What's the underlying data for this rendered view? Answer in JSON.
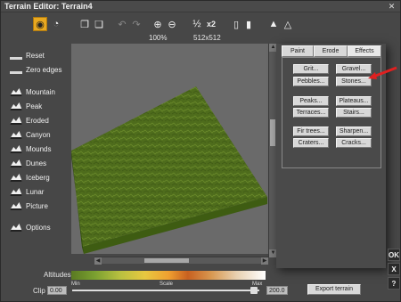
{
  "window": {
    "title": "Terrain Editor: Terrain4",
    "close": "✕"
  },
  "toolbar": {
    "zoom": "100%",
    "resolution": "512x512",
    "x2_label": "x2"
  },
  "left_panel": {
    "items": [
      {
        "label": "Reset",
        "icon": "reset-icon"
      },
      {
        "label": "Zero edges",
        "icon": "zero-edges-icon"
      },
      {
        "label": "Mountain",
        "icon": "mountain-icon"
      },
      {
        "label": "Peak",
        "icon": "peak-icon"
      },
      {
        "label": "Eroded",
        "icon": "eroded-icon"
      },
      {
        "label": "Canyon",
        "icon": "canyon-icon"
      },
      {
        "label": "Mounds",
        "icon": "mounds-icon"
      },
      {
        "label": "Dunes",
        "icon": "dunes-icon"
      },
      {
        "label": "Iceberg",
        "icon": "iceberg-icon"
      },
      {
        "label": "Lunar",
        "icon": "lunar-icon"
      },
      {
        "label": "Picture",
        "icon": "picture-icon"
      },
      {
        "label": "Options",
        "icon": "options-icon"
      }
    ]
  },
  "altitudes": {
    "label": "Altitudes",
    "min": "Min",
    "scale": "Scale",
    "max": "Max"
  },
  "clip": {
    "label": "Clip",
    "min_value": "0.00",
    "max_value": "200.0"
  },
  "export_label": "Export terrain",
  "tabs": [
    "Paint",
    "Erode",
    "Effects"
  ],
  "active_tab": "Effects",
  "effects": [
    [
      "Grit...",
      "Gravel..."
    ],
    [
      "Pebbles...",
      "Stones..."
    ],
    [
      "Peaks...",
      "Plateaus..."
    ],
    [
      "Terraces...",
      "Stairs..."
    ],
    [
      "Fir trees...",
      "Sharpen..."
    ],
    [
      "Craters...",
      "Cracks..."
    ]
  ],
  "side_buttons": [
    "OK",
    "X",
    "?"
  ],
  "colors": {
    "accent": "#e8a820",
    "terrain": "#4a6a18",
    "arrow": "#e02020"
  }
}
